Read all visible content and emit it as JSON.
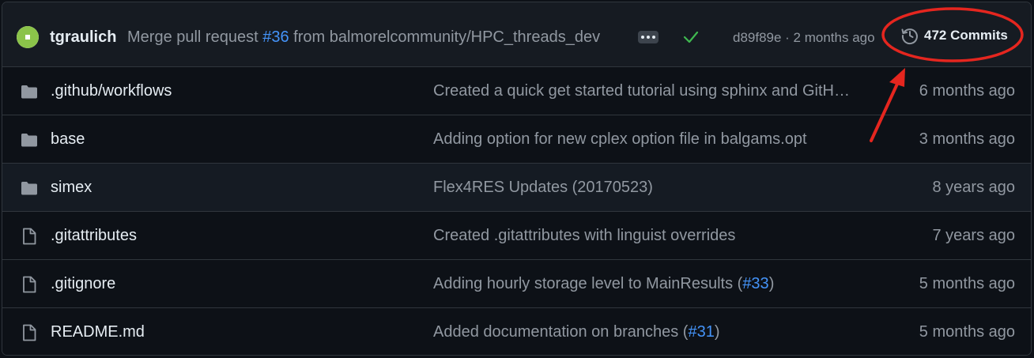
{
  "header": {
    "author": "tgraulich",
    "message_prefix": "Merge pull request ",
    "pr_link": "#36",
    "message_suffix": " from balmorelcommunity/HPC_threads_dev",
    "sha_time": "d89f89e · 2 months ago",
    "commits_label": "472 Commits",
    "icons": {
      "avatar": "identicon-avatar",
      "more": "ellipsis-icon",
      "status": "check-icon",
      "history": "history-clock-icon"
    },
    "colors": {
      "status_green": "#3fb950",
      "link_blue": "#4493f8",
      "annotation_red": "#e5261f"
    }
  },
  "rows": [
    {
      "type": "folder",
      "name": ".github/workflows",
      "msg_prefix": "Created a quick get started tutorial using sphinx and GitH…",
      "link": "",
      "msg_suffix": "",
      "age": "6 months ago"
    },
    {
      "type": "folder",
      "name": "base",
      "msg_prefix": "Adding option for new cplex option file in balgams.opt",
      "link": "",
      "msg_suffix": "",
      "age": "3 months ago"
    },
    {
      "type": "folder",
      "name": "simex",
      "msg_prefix": "Flex4RES Updates (20170523)",
      "link": "",
      "msg_suffix": "",
      "age": "8 years ago"
    },
    {
      "type": "file",
      "name": ".gitattributes",
      "msg_prefix": "Created .gitattributes with linguist overrides",
      "link": "",
      "msg_suffix": "",
      "age": "7 years ago"
    },
    {
      "type": "file",
      "name": ".gitignore",
      "msg_prefix": "Adding hourly storage level to MainResults (",
      "link": "#33",
      "msg_suffix": ")",
      "age": "5 months ago"
    },
    {
      "type": "file",
      "name": "README.md",
      "msg_prefix": "Added documentation on branches (",
      "link": "#31",
      "msg_suffix": ")",
      "age": "5 months ago"
    }
  ]
}
